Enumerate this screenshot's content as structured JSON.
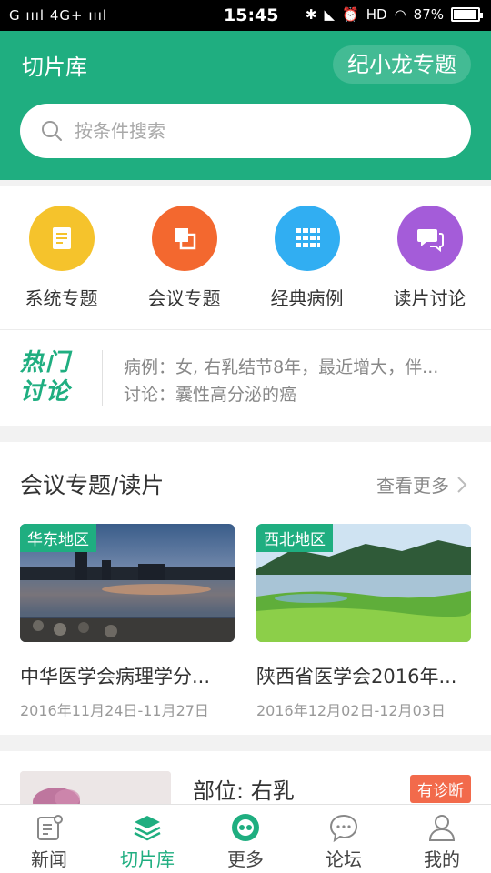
{
  "status_bar": {
    "carrier_left": "G",
    "network": "4G+",
    "time": "15:45",
    "hd": "HD",
    "battery": "87%"
  },
  "header": {
    "title": "切片库",
    "topic_button": "纪小龙专题",
    "search_placeholder": "按条件搜索",
    "bg_color": "#1fae80"
  },
  "shortcuts": [
    {
      "label": "系统专题",
      "icon": "document-icon",
      "color": "#f5c32c"
    },
    {
      "label": "会议专题",
      "icon": "layers-icon",
      "color": "#f3682f"
    },
    {
      "label": "经典病例",
      "icon": "grid-icon",
      "color": "#31aef2"
    },
    {
      "label": "读片讨论",
      "icon": "chat-icon",
      "color": "#a45cd9"
    }
  ],
  "hot_discussion": {
    "logo_line1": "热门",
    "logo_line2": "讨论",
    "line1": "病例：女, 右乳结节8年，最近增大，伴...",
    "line2": "讨论：囊性高分泌的癌"
  },
  "meeting_section": {
    "title": "会议专题/读片",
    "more": "查看更多",
    "cards": [
      {
        "tag": "华东地区",
        "title": "中华医学会病理学分...",
        "date": "2016年11月24日-11月27日"
      },
      {
        "tag": "西北地区",
        "title": "陕西省医学会2016年...",
        "date": "2016年12月02日-12月03日"
      }
    ]
  },
  "next_item": {
    "part": "部位: 右乳",
    "badge": "有诊断"
  },
  "bottom_nav": [
    {
      "label": "新闻",
      "icon": "news-icon",
      "active": false
    },
    {
      "label": "切片库",
      "icon": "stack-icon",
      "active": true
    },
    {
      "label": "更多",
      "icon": "more-icon",
      "active": false
    },
    {
      "label": "论坛",
      "icon": "forum-icon",
      "active": false
    },
    {
      "label": "我的",
      "icon": "user-icon",
      "active": false
    }
  ],
  "colors": {
    "accent": "#1fae80",
    "badge": "#f26a4b"
  }
}
